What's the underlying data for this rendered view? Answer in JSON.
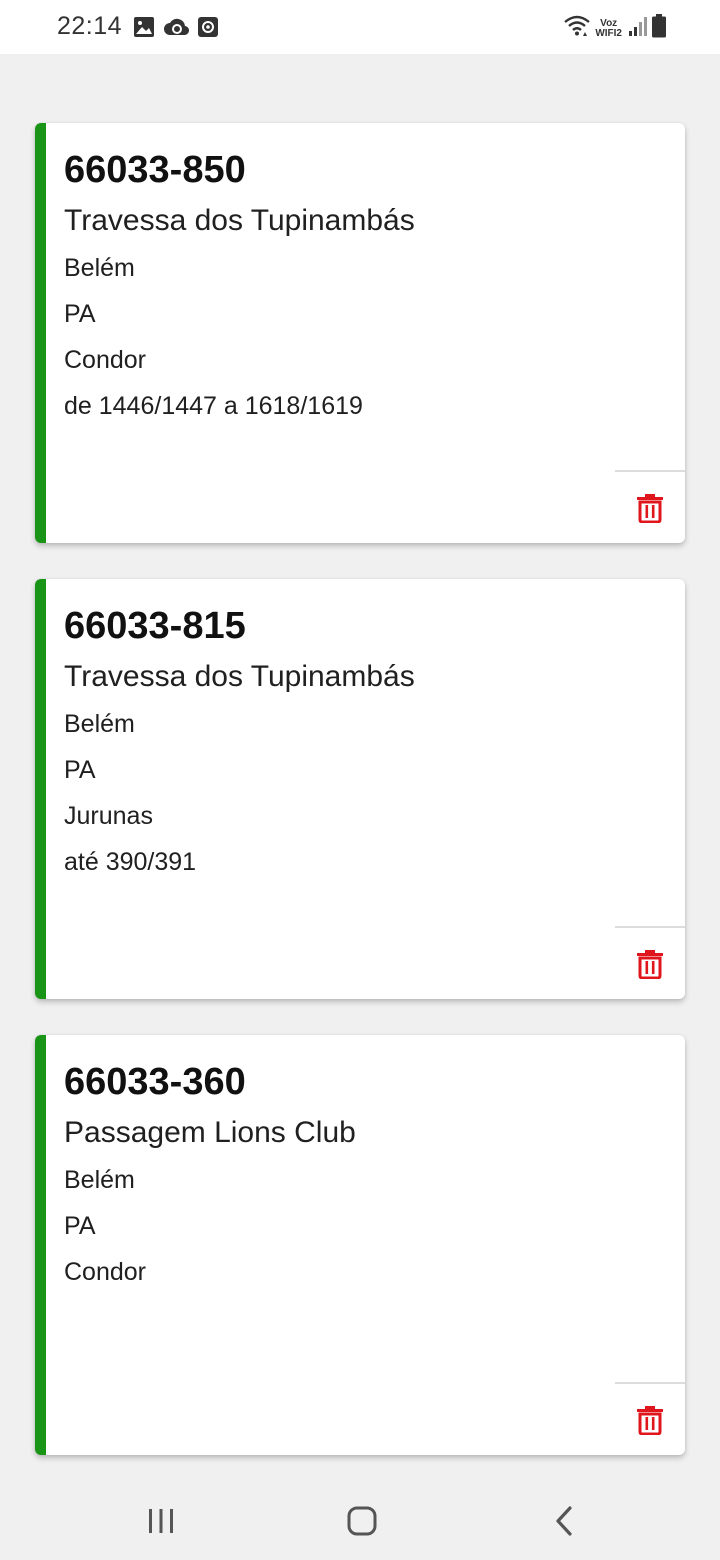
{
  "status_bar": {
    "time": "22:14",
    "left_icons": [
      "image-icon",
      "cloud-sync-icon",
      "screen-record-icon"
    ],
    "right_icons": [
      "wifi-icon",
      "voz-wifi-icon",
      "signal-icon",
      "battery-icon"
    ],
    "voz_label": "Voz",
    "wifi_label": "WIFI2"
  },
  "colors": {
    "accent_bar": "#1a9417",
    "delete_icon": "#e0161d",
    "background": "#f0f0f0",
    "card": "#ffffff"
  },
  "cards": [
    {
      "cep": "66033-850",
      "street": "Travessa dos Tupinambás",
      "city": "Belém",
      "state": "PA",
      "neighborhood": "Condor",
      "complement": "de 1446/1447 a 1618/1619",
      "delete_icon": "trash-icon"
    },
    {
      "cep": "66033-815",
      "street": "Travessa dos Tupinambás",
      "city": "Belém",
      "state": "PA",
      "neighborhood": "Jurunas",
      "complement": "até 390/391",
      "delete_icon": "trash-icon"
    },
    {
      "cep": "66033-360",
      "street": "Passagem Lions Club",
      "city": "Belém",
      "state": "PA",
      "neighborhood": "Condor",
      "complement": "",
      "delete_icon": "trash-icon"
    }
  ],
  "nav_bar": {
    "buttons": [
      "recent-apps-icon",
      "home-icon",
      "back-icon"
    ]
  }
}
